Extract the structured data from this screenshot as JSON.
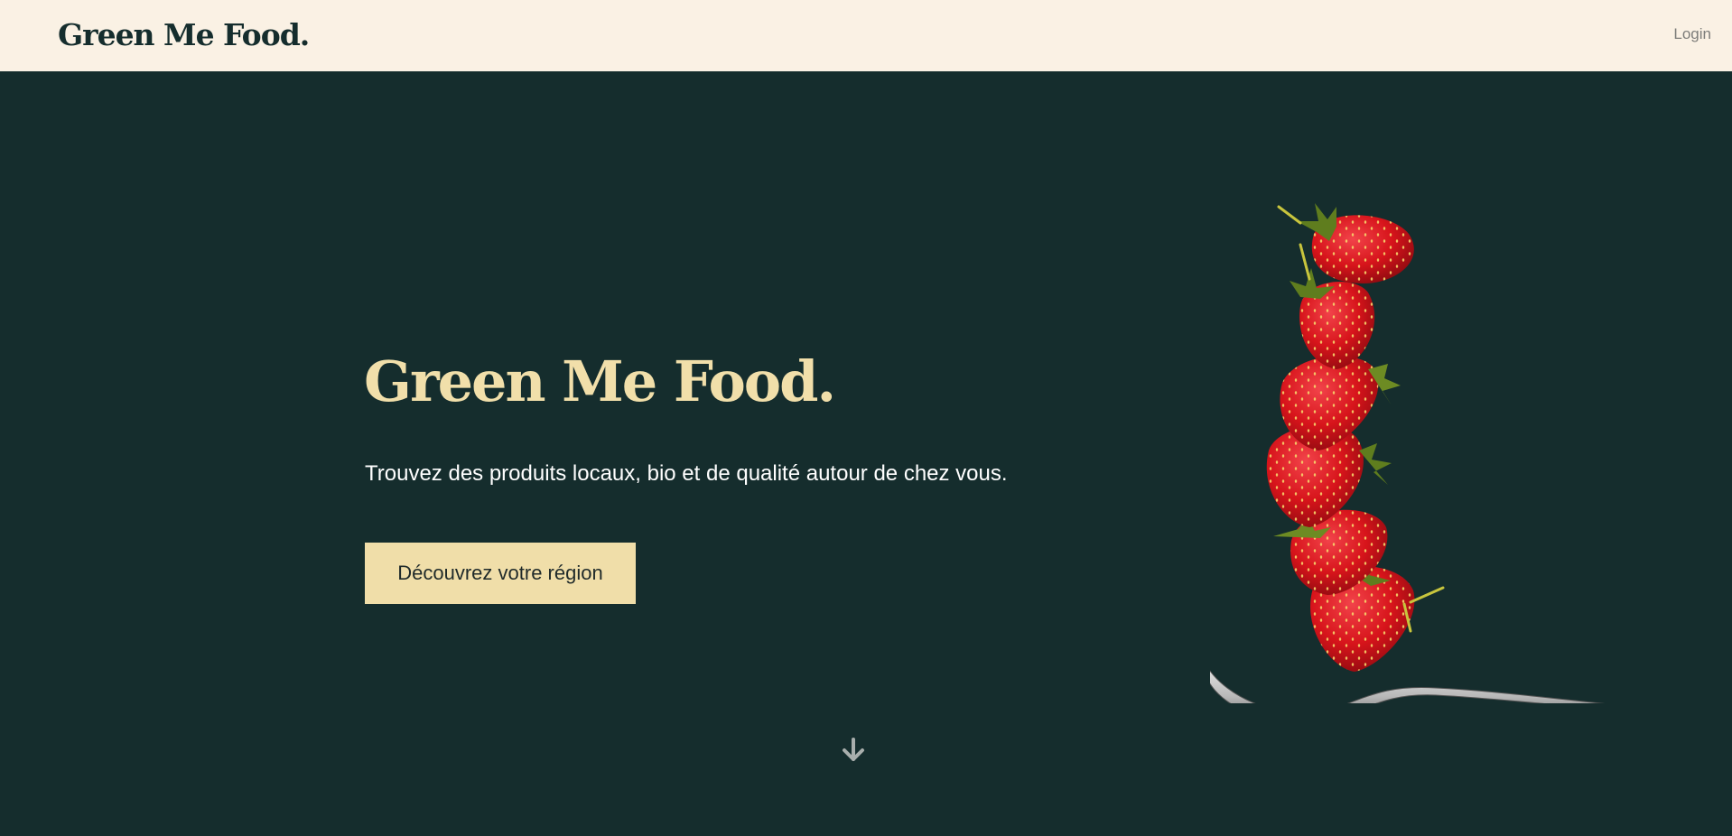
{
  "header": {
    "brand": "Green Me Food.",
    "login_label": "Login"
  },
  "hero": {
    "title": "Green Me Food.",
    "subtitle": "Trouvez des produits locaux, bio et de qualité autour de chez vous.",
    "cta_label": "Découvrez votre région",
    "scroll_icon": "arrow-down-icon",
    "image_subject": "strawberries-on-spoon"
  },
  "colors": {
    "background": "#152d2d",
    "header_bg": "#faf1e4",
    "accent": "#f0dea9",
    "title": "#f1dfaa",
    "strawberry": "#d7141b"
  }
}
